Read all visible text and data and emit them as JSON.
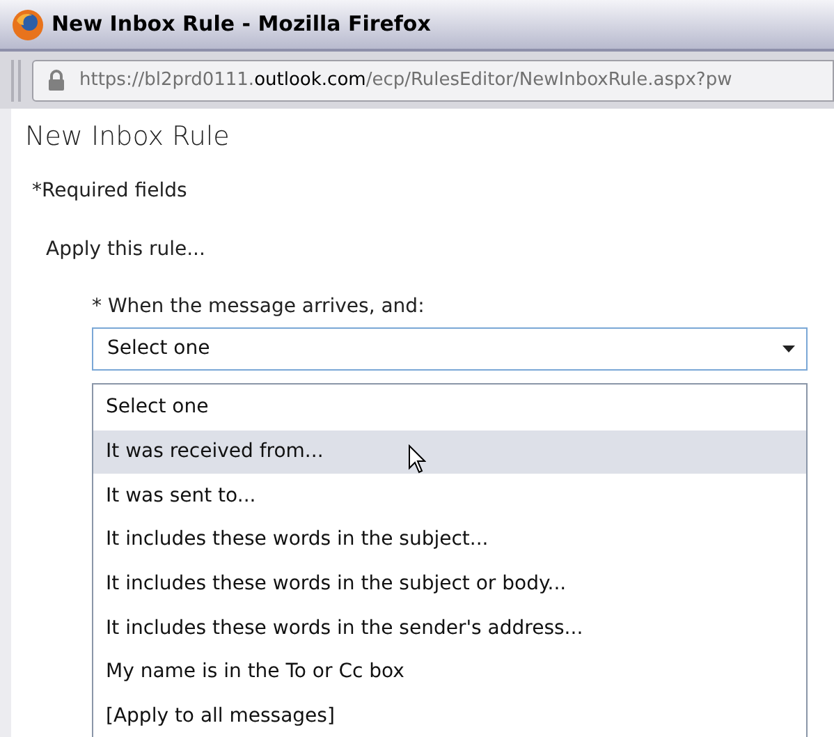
{
  "window": {
    "title": "New Inbox Rule - Mozilla Firefox"
  },
  "address_bar": {
    "prefix": "https://bl2prd0111.",
    "domain": "outlook.com",
    "path": "/ecp/RulesEditor/NewInboxRule.aspx?pw"
  },
  "page": {
    "heading": "New Inbox Rule",
    "required_note": "*Required fields",
    "section": "Apply this rule...",
    "condition": {
      "label": "* When the message arrives, and:",
      "value": "Select one",
      "expanded": true,
      "options": [
        {
          "label": "Select one",
          "hovered": false
        },
        {
          "label": "It was received from...",
          "hovered": true
        },
        {
          "label": "It was sent to...",
          "hovered": false
        },
        {
          "label": "It includes these words in the subject...",
          "hovered": false
        },
        {
          "label": "It includes these words in the subject or body...",
          "hovered": false
        },
        {
          "label": "It includes these words in the sender's address...",
          "hovered": false
        },
        {
          "label": "My name is in the To or Cc box",
          "hovered": false
        },
        {
          "label": "[Apply to all messages]",
          "hovered": false
        }
      ]
    }
  }
}
